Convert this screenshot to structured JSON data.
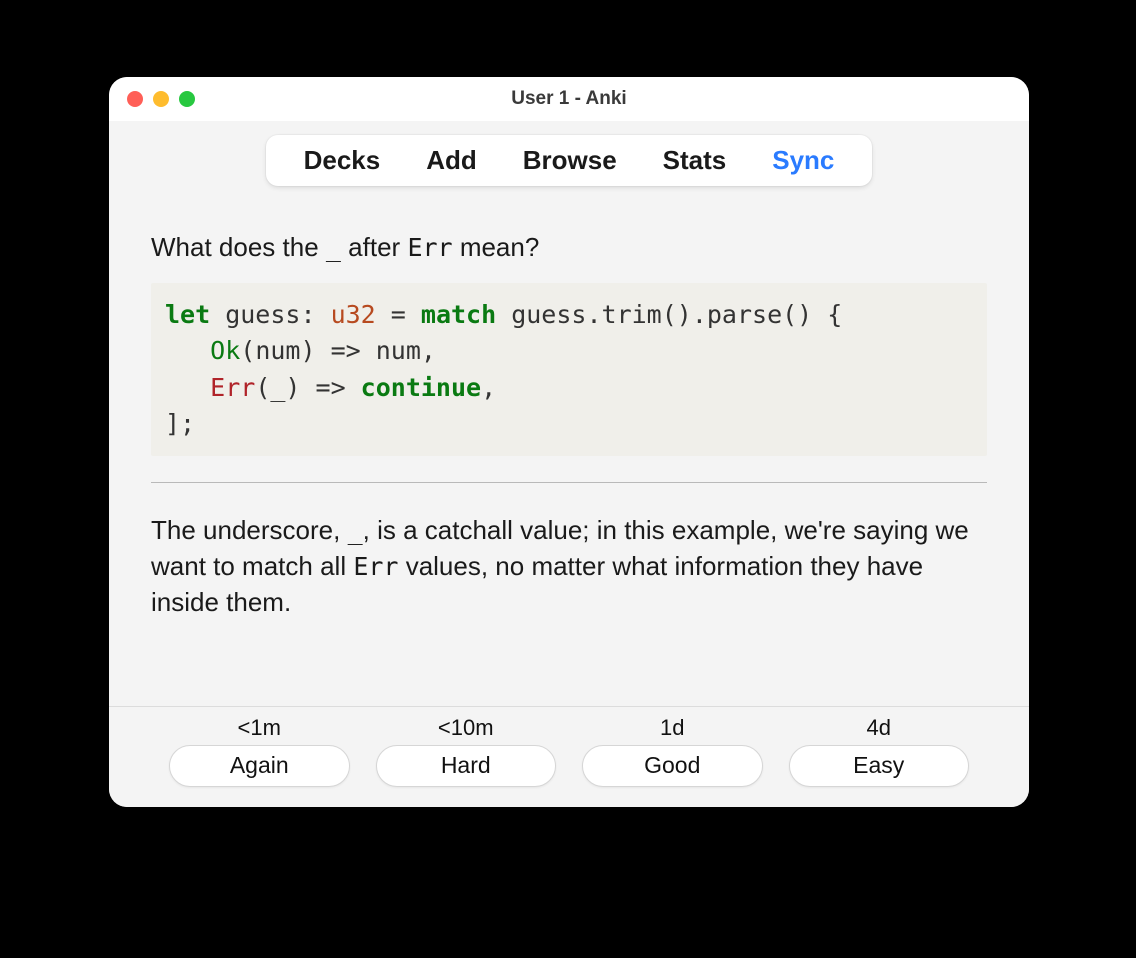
{
  "window": {
    "title": "User 1 - Anki"
  },
  "toolbar": {
    "items": [
      {
        "label": "Decks",
        "active": false
      },
      {
        "label": "Add",
        "active": false
      },
      {
        "label": "Browse",
        "active": false
      },
      {
        "label": "Stats",
        "active": false
      },
      {
        "label": "Sync",
        "active": true
      }
    ]
  },
  "card": {
    "question_prefix": "What does the ",
    "question_mid": " after ",
    "question_token": "Err",
    "question_suffix": " mean?",
    "underscore": "_",
    "code": {
      "kw_let": "let",
      "var": " guess: ",
      "ty": "u32",
      "eq": " = ",
      "kw_match": "match",
      "expr": " guess.trim().parse() {",
      "indent": "   ",
      "ok": "Ok",
      "ok_body": "(num) => num,",
      "err": "Err",
      "err_open": "(_) => ",
      "kw_continue": "continue",
      "err_end": ",",
      "close": "];"
    },
    "answer_p1": "The underscore, ",
    "answer_us": "_",
    "answer_p2": ", is a catchall value; in this example, we're saying we want to match all ",
    "answer_err": "Err",
    "answer_p3": " values, no matter what information they have inside them."
  },
  "ease": [
    {
      "time": "<1m",
      "label": "Again"
    },
    {
      "time": "<10m",
      "label": "Hard"
    },
    {
      "time": "1d",
      "label": "Good"
    },
    {
      "time": "4d",
      "label": "Easy"
    }
  ]
}
